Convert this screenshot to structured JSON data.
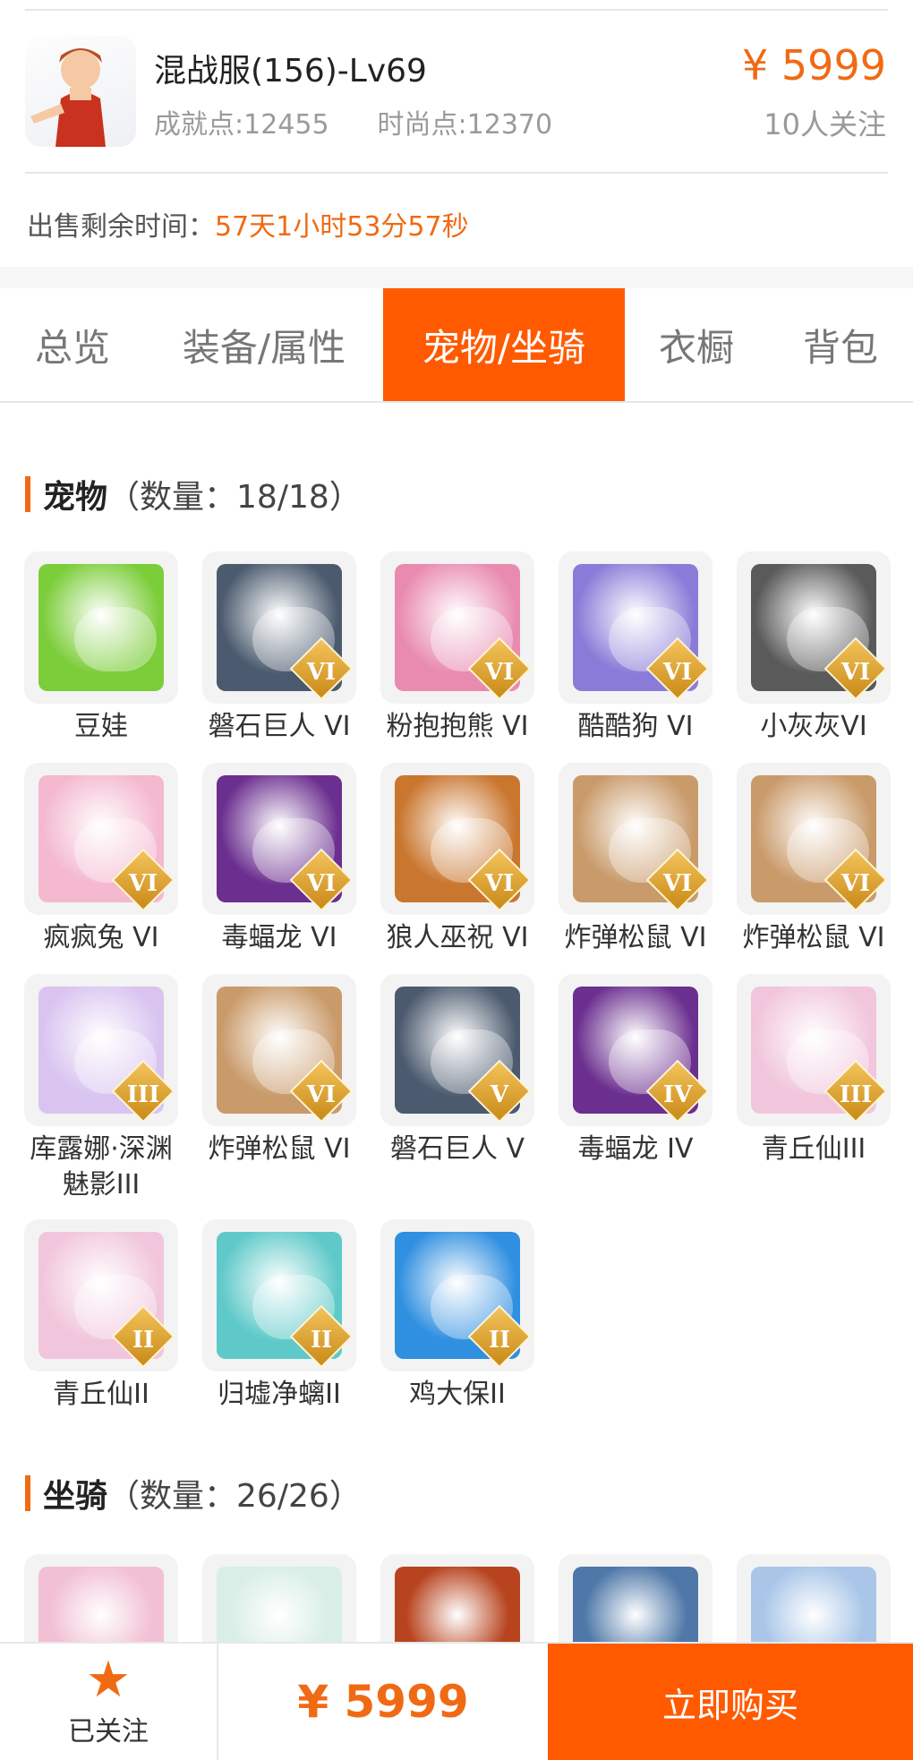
{
  "header": {
    "server": "混战服(156)-Lv69",
    "achievement": "成就点:12455",
    "fashion": "时尚点:12370",
    "price": "¥ 5999",
    "followers": "10人关注",
    "remain_label": "出售剩余时间：",
    "remain_value": "57天1小时53分57秒"
  },
  "tabs": [
    "总览",
    "装备/属性",
    "宠物/坐骑",
    "衣橱",
    "背包"
  ],
  "pets_section": {
    "name": "宠物",
    "count": "（数量：18/18）"
  },
  "pets": [
    {
      "label": "豆娃",
      "badge": "",
      "color": "#7ccd3a"
    },
    {
      "label": "磐石巨人 VI",
      "badge": "VI",
      "color": "#4b5a6e"
    },
    {
      "label": "粉抱抱熊 VI",
      "badge": "VI",
      "color": "#e98bb0"
    },
    {
      "label": "酷酷狗 VI",
      "badge": "VI",
      "color": "#8a7bd8"
    },
    {
      "label": "小灰灰VI",
      "badge": "VI",
      "color": "#5a5a5a"
    },
    {
      "label": "疯疯兔 VI",
      "badge": "VI",
      "color": "#f4b8cf"
    },
    {
      "label": "毒蝠龙 VI",
      "badge": "VI",
      "color": "#6b2f8f"
    },
    {
      "label": "狼人巫祝 VI",
      "badge": "VI",
      "color": "#c9762e"
    },
    {
      "label": "炸弹松鼠 VI",
      "badge": "VI",
      "color": "#c99a6a"
    },
    {
      "label": "炸弹松鼠 VI",
      "badge": "VI",
      "color": "#c99a6a"
    },
    {
      "label": "库露娜·深渊魅影III",
      "badge": "III",
      "color": "#d9c4f0"
    },
    {
      "label": "炸弹松鼠 VI",
      "badge": "VI",
      "color": "#c99a6a"
    },
    {
      "label": "磐石巨人 V",
      "badge": "V",
      "color": "#4b5a6e"
    },
    {
      "label": "毒蝠龙 IV",
      "badge": "IV",
      "color": "#6b2f8f"
    },
    {
      "label": "青丘仙III",
      "badge": "III",
      "color": "#f1c6dc"
    },
    {
      "label": "青丘仙II",
      "badge": "II",
      "color": "#f1c6dc"
    },
    {
      "label": "归墟净螭II",
      "badge": "II",
      "color": "#5fc9c9"
    },
    {
      "label": "鸡大保II",
      "badge": "II",
      "color": "#2f8fe0"
    }
  ],
  "mounts_section": {
    "name": "坐骑",
    "count": "（数量：26/26）"
  },
  "mounts": [
    {
      "color": "#f2c0d4"
    },
    {
      "color": "#d8eee6"
    },
    {
      "color": "#b8441f"
    },
    {
      "color": "#4f78a8"
    },
    {
      "color": "#a9c6e8"
    }
  ],
  "bottom": {
    "follow_label": "已关注",
    "price": "¥ 5999",
    "buy_label": "立即购买"
  }
}
